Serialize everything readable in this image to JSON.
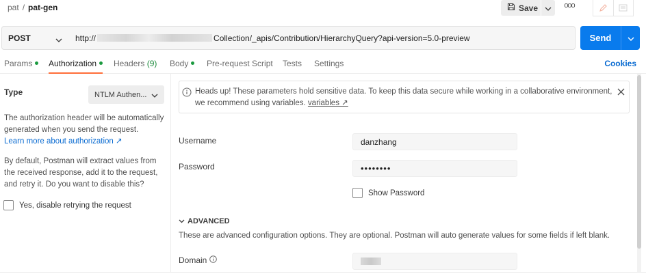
{
  "breadcrumb": {
    "parent": "pat",
    "separator": "/",
    "current": "pat-gen"
  },
  "toolbar": {
    "save_label": "Save",
    "more_label": "ooo"
  },
  "request": {
    "method": "POST",
    "url_prefix": "http://",
    "url_suffix": "Collection/_apis/Contribution/HierarchyQuery?api-version=5.0-preview",
    "send_label": "Send"
  },
  "tabs": [
    {
      "label": "Params",
      "count": "",
      "dot": true
    },
    {
      "label": "Authorization",
      "count": "",
      "dot": true,
      "active": true
    },
    {
      "label": "Headers",
      "count": "(9)",
      "dot": false
    },
    {
      "label": "Body",
      "count": "",
      "dot": true
    },
    {
      "label": "Pre-request Script",
      "count": "",
      "dot": false
    },
    {
      "label": "Tests",
      "count": "",
      "dot": false
    },
    {
      "label": "Settings",
      "count": "",
      "dot": false
    }
  ],
  "cookies_label": "Cookies",
  "auth": {
    "type_label": "Type",
    "type_value": "NTLM Authen...",
    "description_1": "The authorization header will be automatically generated when you send the request.",
    "learn_more": "Learn more about authorization ↗",
    "description_2": "By default, Postman will extract values from the received response, add it to the request, and retry it. Do you want to disable this?",
    "disable_retry_label": "Yes, disable retrying the request"
  },
  "alert": {
    "message": "Heads up! These parameters hold sensitive data. To keep this data secure while working in a collaborative environment, we recommend using variables.",
    "link_label": "variables ↗"
  },
  "fields": {
    "username_label": "Username",
    "username_value": "danzhang",
    "password_label": "Password",
    "password_value": "••••••••",
    "show_password_label": "Show Password"
  },
  "advanced": {
    "title": "ADVANCED",
    "description": "These are advanced configuration options. They are optional. Postman will auto generate values for some fields if left blank.",
    "domain_label": "Domain"
  },
  "colors": {
    "accent": "#ff6c37",
    "send": "#097bed",
    "link": "#0a6bd1",
    "dot": "#1b9a3f"
  }
}
